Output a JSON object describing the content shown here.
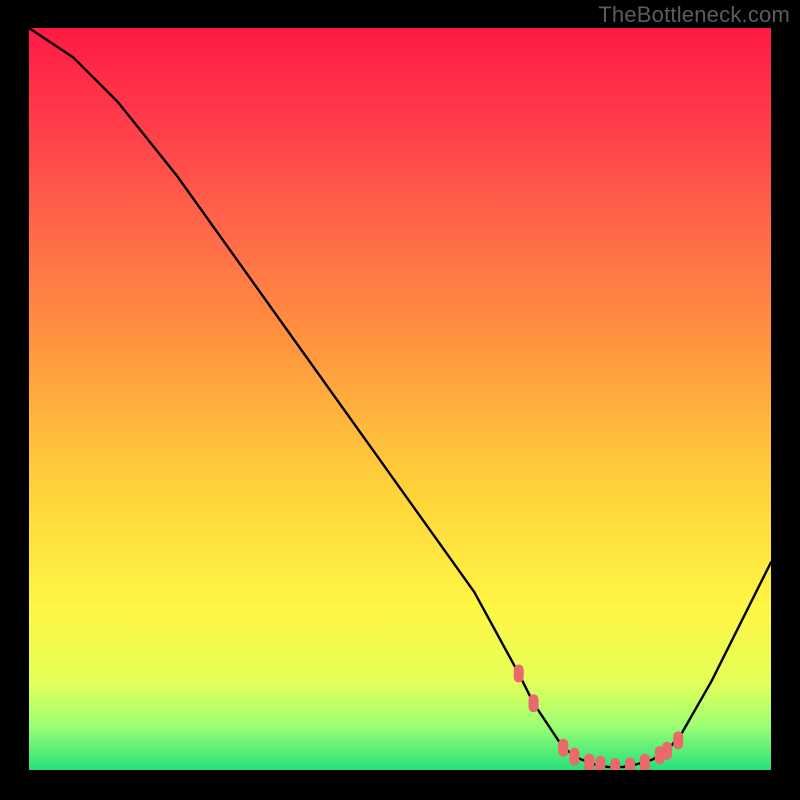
{
  "watermark": "TheBottleneck.com",
  "colors": {
    "curve_stroke": "#000000",
    "marker_fill": "#e86a6a",
    "gradient_stops": [
      {
        "offset": "0%",
        "color": "#ff1a44"
      },
      {
        "offset": "12%",
        "color": "#ff3a4a"
      },
      {
        "offset": "28%",
        "color": "#ff6a48"
      },
      {
        "offset": "45%",
        "color": "#ff9c3e"
      },
      {
        "offset": "62%",
        "color": "#ffd23a"
      },
      {
        "offset": "78%",
        "color": "#fff645"
      },
      {
        "offset": "88%",
        "color": "#e6ff57"
      },
      {
        "offset": "94%",
        "color": "#9dff74"
      },
      {
        "offset": "100%",
        "color": "#26e07a"
      }
    ]
  },
  "chart_data": {
    "type": "line",
    "title": "",
    "xlabel": "",
    "ylabel": "",
    "xlim": [
      0,
      100
    ],
    "ylim": [
      0,
      100
    ],
    "series": [
      {
        "name": "curve",
        "x": [
          0,
          6,
          12,
          20,
          30,
          40,
          50,
          60,
          66,
          68,
          70,
          72,
          74,
          76,
          78,
          80,
          82,
          84,
          86,
          88,
          92,
          100
        ],
        "y": [
          100,
          96,
          90,
          80,
          66,
          52,
          38,
          24,
          13,
          9,
          6,
          3,
          1.6,
          0.8,
          0.4,
          0.4,
          0.8,
          1.4,
          2.6,
          5,
          12,
          28
        ]
      }
    ],
    "markers": {
      "name": "highlight-points",
      "x": [
        66,
        68,
        72,
        73.5,
        75.5,
        77,
        79,
        81,
        83,
        85,
        86,
        87.5
      ],
      "y": [
        13,
        9,
        3,
        1.8,
        1.0,
        0.7,
        0.4,
        0.5,
        1.0,
        2.0,
        2.6,
        4.0
      ]
    }
  }
}
